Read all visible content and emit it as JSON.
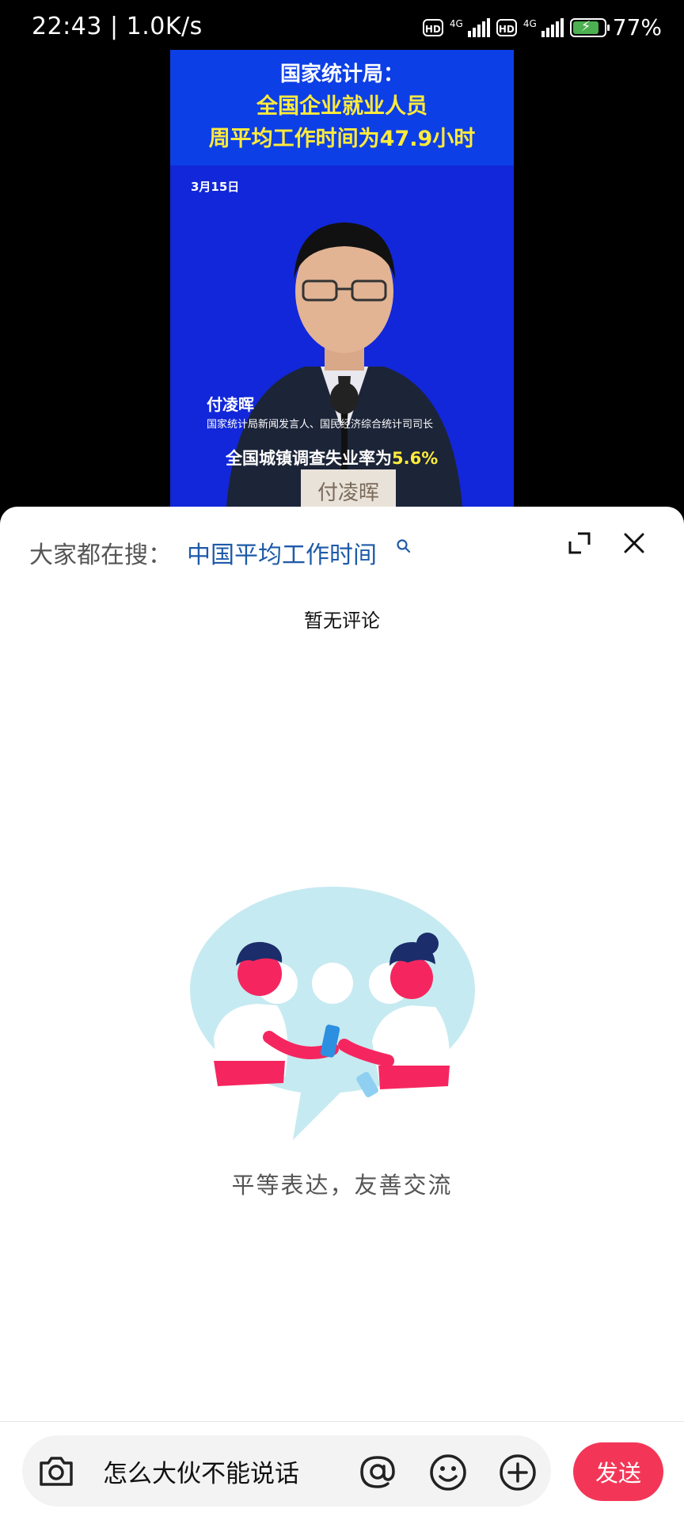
{
  "status_bar": {
    "time": "22:43 | 1.0K/s",
    "hd_label": "HD",
    "network_label": "4G",
    "battery_text": "77%",
    "battery_level": 0.77
  },
  "video": {
    "title_line1": "国家统计局：",
    "title_line2": "全国企业就业人员",
    "title_line3": "周平均工作时间为47.9小时",
    "date": "3月15日",
    "speaker_name": "付凌晖",
    "speaker_role": "国家统计局新闻发言人、国民经济综合统计司司长",
    "stat_prefix": "全国城镇调查失业率为",
    "stat_value": "5.6%",
    "nameplate": "付凌晖"
  },
  "comments": {
    "trending_label": "大家都在搜：",
    "trending_query": "中国平均工作时间",
    "empty_title": "暂无评论",
    "empty_tagline": "平等表达，友善交流"
  },
  "input_bar": {
    "input_value": "怎么大伙不能说话",
    "send_label": "发送"
  },
  "colors": {
    "accent": "#f33657",
    "link": "#1e5aa8",
    "video_bg": "#1227d9"
  },
  "icons": [
    "search-icon",
    "expand-icon",
    "close-icon",
    "camera-icon",
    "at-icon",
    "emoji-icon",
    "plus-icon"
  ]
}
